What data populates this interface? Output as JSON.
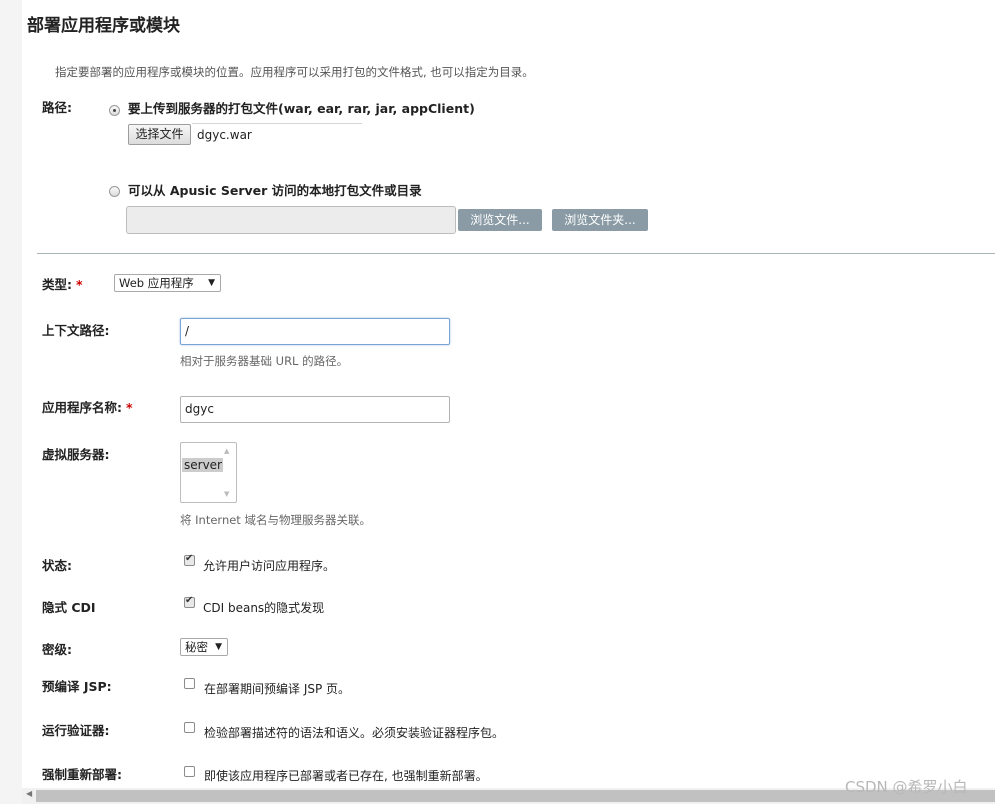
{
  "page": {
    "title": "部署应用程序或模块",
    "intro": "指定要部署的应用程序或模块的位置。应用程序可以采用打包的文件格式, 也可以指定为目录。"
  },
  "path": {
    "label": "路径:",
    "upload_option": "要上传到服务器的打包文件(war, ear, rar, jar, appClient)",
    "choose_file_button": "选择文件",
    "chosen_file": "dgyc.war",
    "local_option": "可以从 Apusic Server 访问的本地打包文件或目录",
    "local_path_value": "",
    "browse_files_button": "浏览文件...",
    "browse_folder_button": "浏览文件夹..."
  },
  "type": {
    "label": "类型:",
    "required": "*",
    "selected": "Web 应用程序"
  },
  "context_root": {
    "label": "上下文路径:",
    "value": "/",
    "hint": "相对于服务器基础 URL 的路径。"
  },
  "app_name": {
    "label": "应用程序名称:",
    "required": "*",
    "value": "dgyc"
  },
  "virtual_servers": {
    "label": "虚拟服务器:",
    "items": [
      "server"
    ],
    "hint": "将 Internet 域名与物理服务器关联。"
  },
  "status": {
    "label": "状态:",
    "checked": true,
    "text": "允许用户访问应用程序。"
  },
  "implicit_cdi": {
    "label": "隐式 CDI",
    "checked": true,
    "text": "CDI beans的隐式发现"
  },
  "security_level": {
    "label": "密级:",
    "selected": "秘密"
  },
  "precompile_jsp": {
    "label": "预编译 JSP:",
    "checked": false,
    "text": "在部署期间预编译 JSP 页。"
  },
  "run_verifier": {
    "label": "运行验证器:",
    "checked": false,
    "text": "检验部署描述符的语法和语义。必须安装验证器程序包。"
  },
  "force_redeploy": {
    "label": "强制重新部署:",
    "checked": false,
    "text": "即使该应用程序已部署或者已存在, 也强制重新部署。"
  },
  "watermark": "CSDN @希罗小白",
  "colors": {
    "required": "#cc0000",
    "gray_button": "#8a9ba5",
    "divider": "#a8b4ba",
    "focus_border": "#7aa4d6"
  }
}
